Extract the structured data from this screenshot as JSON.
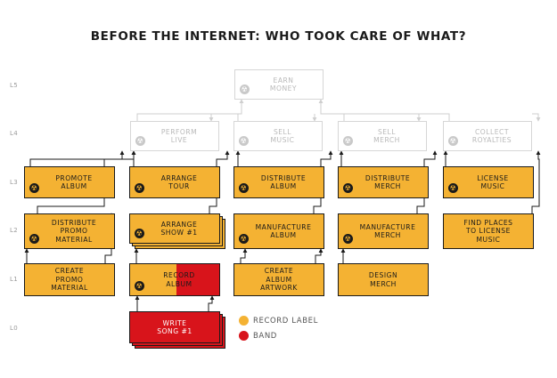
{
  "title": "BEFORE THE INTERNET: WHO TOOK CARE OF WHAT?",
  "levels": [
    "L5",
    "L4",
    "L3",
    "L2",
    "L1",
    "L0"
  ],
  "colors": {
    "record_label": "#f4b233",
    "band": "#d8141b",
    "inactive": "#d6d6d6",
    "border": "#1a1a1a"
  },
  "icon": {
    "name": "record-label-disc-icon",
    "glyph": "☢"
  },
  "nodes": {
    "earn_money": "EARN\nMONEY",
    "perform_live": "PERFORM\nLIVE",
    "sell_music": "SELL\nMUSIC",
    "sell_merch": "SELL\nMERCH",
    "collect_royalties": "COLLECT\nROYALTIES",
    "promote_album": "PROMOTE\nALBUM",
    "arrange_tour": "ARRANGE\nTOUR",
    "distribute_album": "DISTRIBUTE\nALBUM",
    "distribute_merch": "DISTRIBUTE\nMERCH",
    "license_music": "LICENSE\nMUSIC",
    "distribute_promo_material": "DISTRIBUTE\nPROMO\nMATERIAL",
    "arrange_show": "ARRANGE\nSHOW #1",
    "manufacture_album": "MANUFACTURE\nALBUM",
    "manufacture_merch": "MANUFACTURE\nMERCH",
    "find_places_to_license_music": "FIND PLACES\nTO LICENSE\nMUSIC",
    "create_promo_material": "CREATE\nPROMO\nMATERIAL",
    "record_album": "RECORD\nALBUM",
    "create_album_artwork": "CREATE\nALBUM\nARTWORK",
    "design_merch": "DESIGN\nMERCH",
    "write_song": "WRITE\nSONG #1"
  },
  "legend": [
    {
      "label": "RECORD LABEL",
      "color": "#f4b233"
    },
    {
      "label": "BAND",
      "color": "#d8141b"
    }
  ]
}
